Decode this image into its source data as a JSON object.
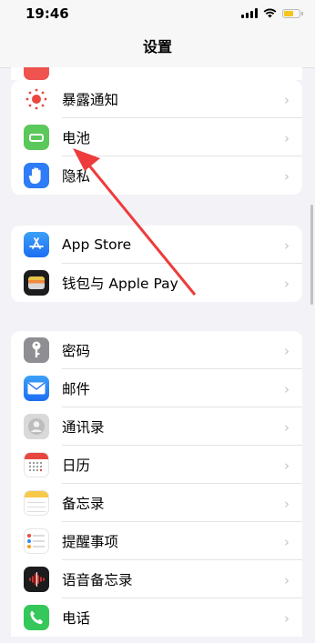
{
  "status": {
    "time": "19:46"
  },
  "nav": {
    "title": "设置"
  },
  "group1": [
    {
      "label": "暴露通知",
      "icon": "exposure-notification-icon",
      "color": "#ffffff"
    },
    {
      "label": "电池",
      "icon": "battery-icon",
      "color": "#5ac85a"
    },
    {
      "label": "隐私",
      "icon": "hand-privacy-icon",
      "color": "#2e7cf6"
    }
  ],
  "group2": [
    {
      "label": "App Store",
      "icon": "app-store-icon",
      "color": "#2f8cf5"
    },
    {
      "label": "钱包与 Apple Pay",
      "icon": "wallet-icon",
      "color": "#1c1c1e"
    }
  ],
  "group3": [
    {
      "label": "密码",
      "icon": "key-icon",
      "color": "#8e8e93"
    },
    {
      "label": "邮件",
      "icon": "mail-icon",
      "color": "#2f8cf5"
    },
    {
      "label": "通讯录",
      "icon": "contacts-icon",
      "color": "#9c9c9c"
    },
    {
      "label": "日历",
      "icon": "calendar-icon",
      "color": "#ffffff"
    },
    {
      "label": "备忘录",
      "icon": "notes-icon",
      "color": "#ffffff"
    },
    {
      "label": "提醒事项",
      "icon": "reminders-icon",
      "color": "#ffffff"
    },
    {
      "label": "语音备忘录",
      "icon": "voice-memos-icon",
      "color": "#1c1c1e"
    },
    {
      "label": "电话",
      "icon": "phone-icon",
      "color": "#35c759"
    }
  ]
}
